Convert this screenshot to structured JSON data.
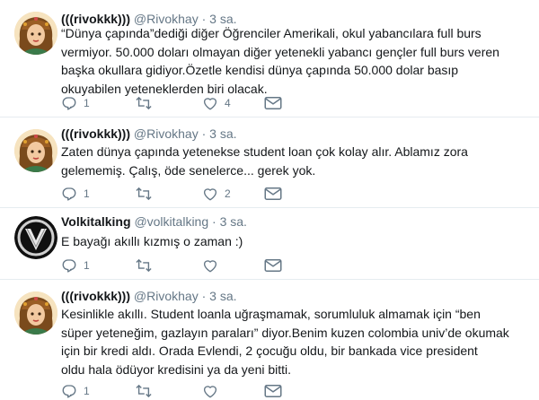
{
  "tweets": [
    {
      "author_name": "(((rivokkk)))",
      "handle": "@Rivokhay",
      "time": "· 3 sa.",
      "lines": [
        "“Dünya çapında”dediği diğer Öğrenciler Amerikali, okul yabancılara full burs",
        "vermiyor. 50.000 doları olmayan diğer yetenekli yabancı gençler full burs veren",
        "başka okullara gidiyor.Özetle kendisi dünya çapında 50.000 dolar basıp",
        "okuyabilen yeteneklerden biri olacak."
      ],
      "reply_count": "1",
      "retweet_count": "",
      "like_count": "4",
      "avatar": "illustrated-woman"
    },
    {
      "author_name": "(((rivokkk)))",
      "handle": "@Rivokhay",
      "time": "· 3 sa.",
      "lines": [
        "Zaten dünya çapında yetenekse student loan çok kolay alır. Ablamız zora",
        "gelememiş.  Çalış, öde senelerce... gerek yok."
      ],
      "reply_count": "1",
      "retweet_count": "",
      "like_count": "2",
      "avatar": "illustrated-woman"
    },
    {
      "author_name": "Volkitalking",
      "handle": "@volkitalking",
      "time": "· 3 sa.",
      "lines": [
        "E bayağı akıllı kızmış o zaman :)"
      ],
      "reply_count": "1",
      "retweet_count": "",
      "like_count": "",
      "avatar": "v-logo"
    },
    {
      "author_name": "(((rivokkk)))",
      "handle": "@Rivokhay",
      "time": "· 3 sa.",
      "lines": [
        "Kesinlikle akıllı. Student loanla uğraşmamak, sorumluluk almamak için “ben",
        "süper yeteneğim, gazlayın paraları” diyor.Benim kuzen colombia univ’de okumak",
        "için bir kredi aldı. Orada Evlendi, 2 çocuğu oldu, bir bankada  vice president",
        "oldu hala ödüyor kredisini ya da yeni bitti."
      ],
      "reply_count": "1",
      "retweet_count": "",
      "like_count": "",
      "avatar": "illustrated-woman"
    }
  ],
  "icons": {
    "reply": "reply-icon",
    "retweet": "retweet-icon",
    "like": "heart-icon",
    "dm": "envelope-icon"
  },
  "colors": {
    "text": "#14171a",
    "secondary": "#657786",
    "divider": "#e6ecf0"
  }
}
